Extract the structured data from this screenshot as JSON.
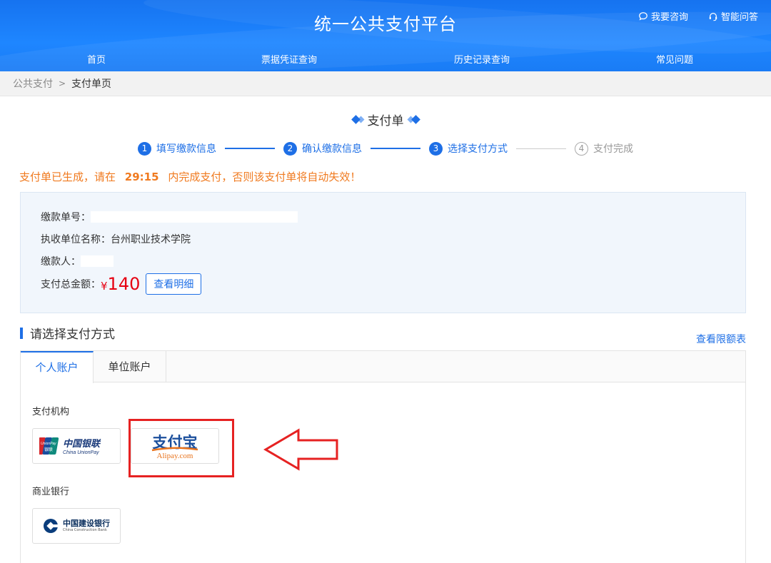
{
  "header": {
    "title": "统一公共支付平台",
    "links": [
      {
        "label": "我要咨询",
        "icon": "chat-bubble-icon"
      },
      {
        "label": "智能问答",
        "icon": "headset-icon"
      }
    ],
    "nav": [
      "首页",
      "票据凭证查询",
      "历史记录查询",
      "常见问题"
    ]
  },
  "breadcrumb": {
    "root": "公共支付",
    "separator": ">",
    "current": "支付单页"
  },
  "page": {
    "title": "支付单"
  },
  "steps": [
    {
      "num": "1",
      "label": "填写缴款信息",
      "state": "done"
    },
    {
      "num": "2",
      "label": "确认缴款信息",
      "state": "done"
    },
    {
      "num": "3",
      "label": "选择支付方式",
      "state": "current"
    },
    {
      "num": "4",
      "label": "支付完成",
      "state": "todo"
    }
  ],
  "warning": {
    "prefix": "支付单已生成，请在",
    "countdown": "29:15",
    "suffix": "内完成支付，否则该支付单将自动失效！"
  },
  "info": {
    "order_label": "缴款单号：",
    "unit_label": "执收单位名称：",
    "unit_value": "台州职业技术学院",
    "payer_label": "缴款人：",
    "amount_label": "支付总金额：",
    "currency": "¥",
    "amount": "140",
    "detail_button": "查看明细"
  },
  "payment": {
    "title": "请选择支付方式",
    "limit_link": "查看限额表",
    "tabs": [
      "个人账户",
      "单位账户"
    ],
    "active_tab": 0,
    "institutions_label": "支付机构",
    "unionpay": {
      "cn": "中国银联",
      "en": "China UnionPay",
      "badge": "UnionPay",
      "badge_cn": "银联"
    },
    "alipay": {
      "cn": "支付宝",
      "en": "Alipay.com"
    },
    "banks_label": "商业银行",
    "ccb": {
      "cn": "中国建设银行",
      "en": "China Construction Bank"
    }
  },
  "colors": {
    "primary": "#1e6fe6",
    "warning": "#f07a1f",
    "amount": "#e60012",
    "highlight": "#e62222"
  }
}
